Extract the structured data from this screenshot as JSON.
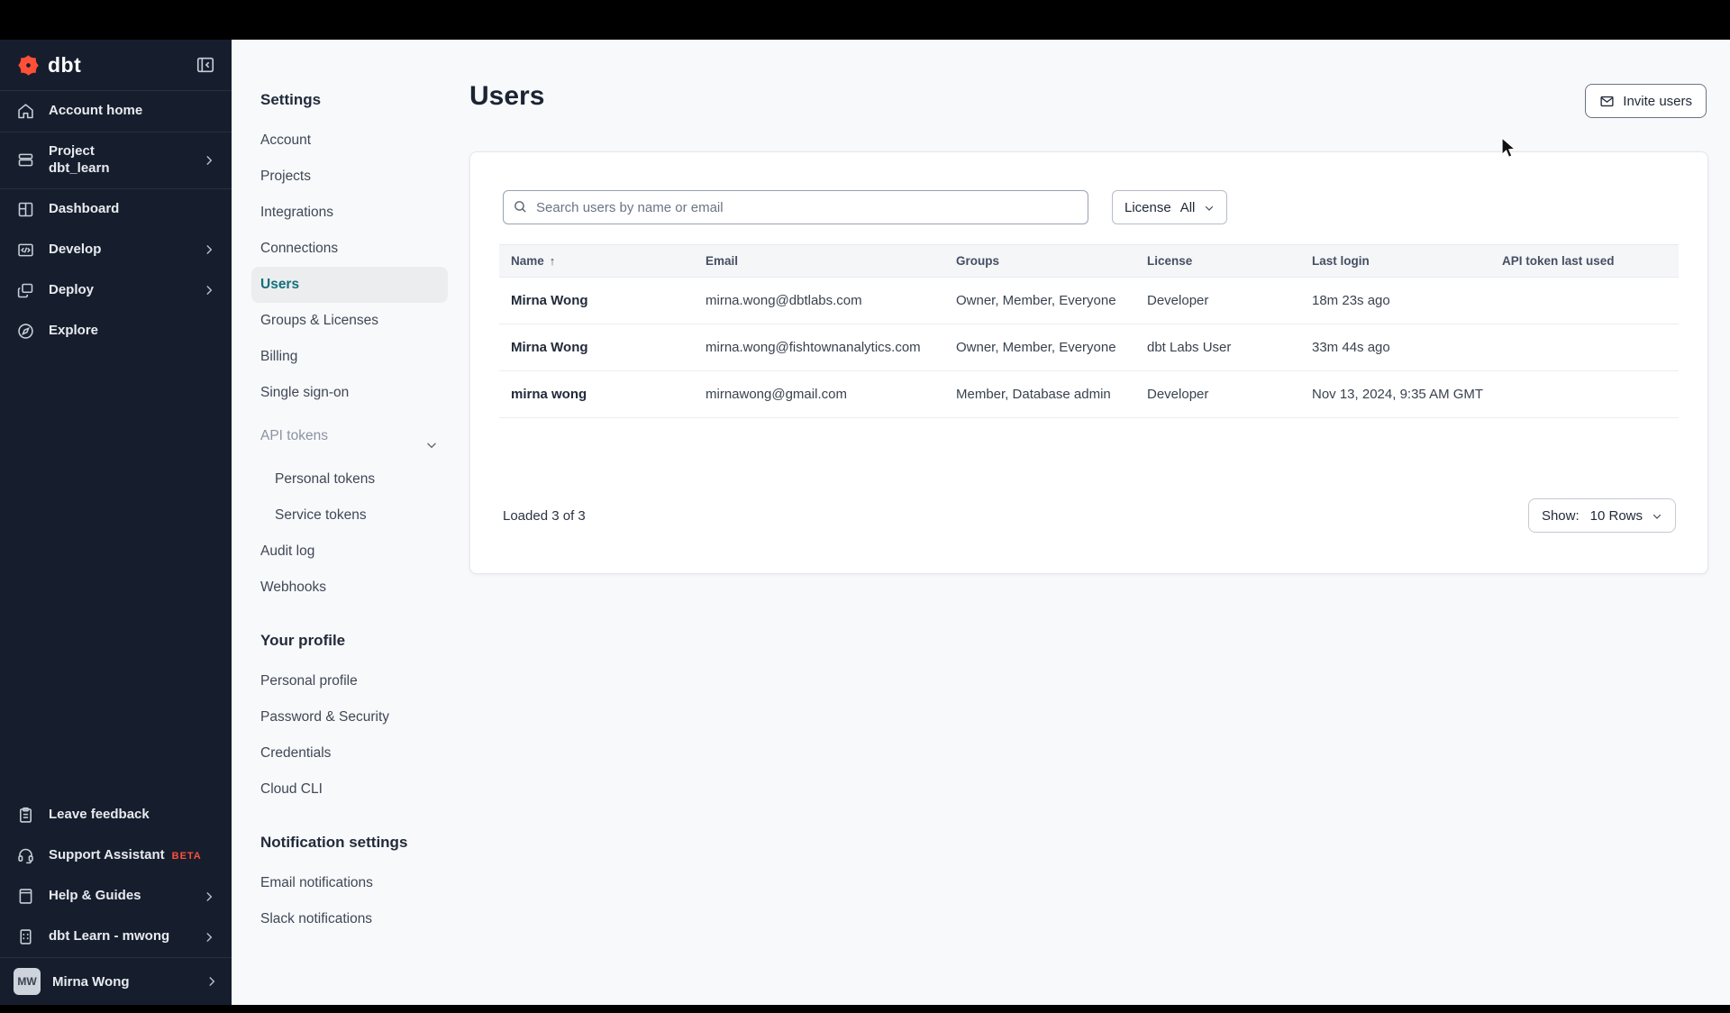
{
  "sidebar": {
    "brand": "dbt",
    "items": [
      {
        "label": "Account home",
        "icon": "home"
      },
      {
        "label": "Project",
        "sublabel": "dbt_learn",
        "icon": "project-box"
      },
      {
        "label": "Dashboard",
        "icon": "dashboard-grid"
      },
      {
        "label": "Develop",
        "icon": "code-window"
      },
      {
        "label": "Deploy",
        "icon": "deploy-windows"
      },
      {
        "label": "Explore",
        "icon": "compass"
      }
    ],
    "footer_items": [
      {
        "label": "Leave feedback",
        "icon": "clipboard"
      },
      {
        "label": "Support Assistant",
        "badge": "BETA",
        "icon": "headset"
      },
      {
        "label": "Help & Guides",
        "icon": "book"
      },
      {
        "label": "dbt Learn - mwong",
        "icon": "building"
      }
    ],
    "user": {
      "initials": "MW",
      "name": "Mirna Wong"
    }
  },
  "settings_nav": {
    "title": "Settings",
    "items": [
      "Account",
      "Projects",
      "Integrations",
      "Connections",
      "Users",
      "Groups & Licenses",
      "Billing",
      "Single sign-on",
      "API tokens",
      "Personal tokens",
      "Service tokens",
      "Audit log",
      "Webhooks"
    ],
    "active_item": "Users",
    "profile_title": "Your profile",
    "profile_items": [
      "Personal profile",
      "Password & Security",
      "Credentials",
      "Cloud CLI"
    ],
    "notifications_title": "Notification settings",
    "notification_items": [
      "Email notifications",
      "Slack notifications"
    ]
  },
  "main": {
    "title": "Users",
    "invite_button": "Invite users",
    "search_placeholder": "Search users by name or email",
    "filter": {
      "label": "License",
      "value": "All"
    },
    "table": {
      "columns": [
        "Name",
        "Email",
        "Groups",
        "License",
        "Last login",
        "API token last used"
      ],
      "sorted_column": "Name",
      "rows": [
        {
          "name": "Mirna Wong",
          "email": "mirna.wong@dbtlabs.com",
          "groups": "Owner, Member, Everyone",
          "license": "Developer",
          "last_login": "18m 23s ago",
          "api_token_last_used": ""
        },
        {
          "name": "Mirna Wong",
          "email": "mirna.wong@fishtownanalytics.com",
          "groups": "Owner, Member, Everyone",
          "license": "dbt Labs User",
          "last_login": "33m 44s ago",
          "api_token_last_used": ""
        },
        {
          "name": "mirna wong",
          "email": "mirnawong@gmail.com",
          "groups": "Member, Database admin",
          "license": "Developer",
          "last_login": "Nov 13, 2024, 9:35 AM GMT",
          "api_token_last_used": ""
        }
      ]
    },
    "footer": {
      "loaded_text": "Loaded 3 of 3",
      "show_label": "Show:",
      "show_value": "10 Rows"
    }
  },
  "colors": {
    "brand_orange": "#FF4F38",
    "active_teal": "#13707C",
    "sidebar_bg": "#161E2D"
  }
}
